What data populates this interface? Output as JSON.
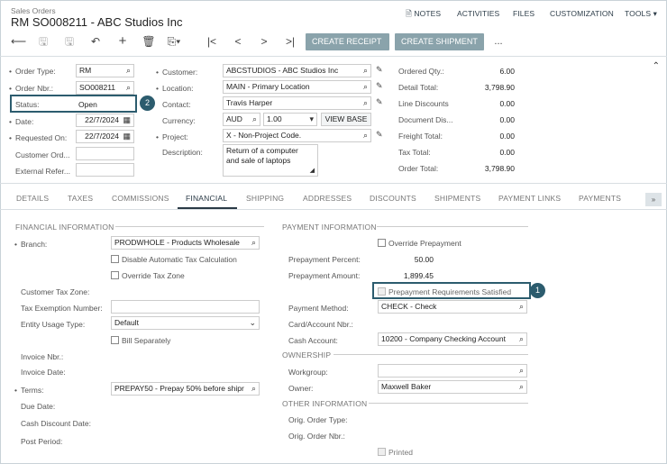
{
  "header": {
    "breadcrumb": "Sales Orders",
    "title": "RM SO008211 - ABC Studios Inc",
    "links": [
      "NOTES",
      "ACTIVITIES",
      "FILES",
      "CUSTOMIZATION",
      "TOOLS"
    ]
  },
  "toolbar": {
    "create_receipt": "CREATE RECEIPT",
    "create_shipment": "CREATE SHIPMENT",
    "more": "..."
  },
  "summary": {
    "order_type_label": "Order Type:",
    "order_type": "RM",
    "order_nbr_label": "Order Nbr.:",
    "order_nbr": "SO008211",
    "status_label": "Status:",
    "status": "Open",
    "date_label": "Date:",
    "date": "22/7/2024",
    "requested_on_label": "Requested On:",
    "requested_on": "22/7/2024",
    "customer_ord_label": "Customer Ord...",
    "external_ref_label": "External Refer...",
    "customer_label": "Customer:",
    "customer": "ABCSTUDIOS - ABC Studios Inc",
    "location_label": "Location:",
    "location": "MAIN - Primary Location",
    "contact_label": "Contact:",
    "contact": "Travis Harper",
    "currency_label": "Currency:",
    "currency": "AUD",
    "rate": "1.00",
    "view_base": "VIEW BASE",
    "project_label": "Project:",
    "project": "X - Non-Project Code.",
    "description_label": "Description:",
    "description_line1": "Return of a computer",
    "description_line2": "and sale of laptops",
    "totals": [
      {
        "label": "Ordered Qty.:",
        "value": "6.00"
      },
      {
        "label": "Detail Total:",
        "value": "3,798.90"
      },
      {
        "label": "Line Discounts",
        "value": "0.00"
      },
      {
        "label": "Document Dis...",
        "value": "0.00"
      },
      {
        "label": "Freight Total:",
        "value": "0.00"
      },
      {
        "label": "Tax Total:",
        "value": "0.00"
      },
      {
        "label": "Order Total:",
        "value": "3,798.90"
      }
    ]
  },
  "tabs": [
    "DETAILS",
    "TAXES",
    "COMMISSIONS",
    "FINANCIAL",
    "SHIPPING",
    "ADDRESSES",
    "DISCOUNTS",
    "SHIPMENTS",
    "PAYMENT LINKS",
    "PAYMENTS"
  ],
  "financial": {
    "section_title": "FINANCIAL INFORMATION",
    "branch_label": "Branch:",
    "branch": "PRODWHOLE - Products Wholesale",
    "disable_auto_tax": "Disable Automatic Tax Calculation",
    "override_tax_zone": "Override Tax Zone",
    "customer_tax_zone_label": "Customer Tax Zone:",
    "tax_exemption_label": "Tax Exemption Number:",
    "entity_usage_label": "Entity Usage Type:",
    "entity_usage": "Default",
    "bill_separately": "Bill Separately",
    "invoice_nbr_label": "Invoice Nbr.:",
    "invoice_date_label": "Invoice Date:",
    "terms_label": "Terms:",
    "terms": "PREPAY50 - Prepay 50% before shipr",
    "due_date_label": "Due Date:",
    "cash_discount_label": "Cash Discount Date:",
    "post_period_label": "Post Period:"
  },
  "payment": {
    "section_title": "PAYMENT INFORMATION",
    "override_prepayment": "Override Prepayment",
    "prepayment_percent_label": "Prepayment Percent:",
    "prepayment_percent": "50.00",
    "prepayment_amount_label": "Prepayment Amount:",
    "prepayment_amount": "1,899.45",
    "prepayment_satisfied": "Prepayment Requirements Satisfied",
    "payment_method_label": "Payment Method:",
    "payment_method": "CHECK - Check",
    "card_account_label": "Card/Account Nbr.:",
    "cash_account_label": "Cash Account:",
    "cash_account": "10200 - Company Checking Account",
    "ownership_title": "OWNERSHIP",
    "workgroup_label": "Workgroup:",
    "owner_label": "Owner:",
    "owner": "Maxwell Baker",
    "other_title": "OTHER INFORMATION",
    "orig_order_type_label": "Orig. Order Type:",
    "orig_order_nbr_label": "Orig. Order Nbr.:",
    "printed": "Printed"
  },
  "callouts": [
    "1",
    "2"
  ],
  "colors": {
    "accent": "#2c5c6e",
    "button": "#8aa3ab"
  }
}
